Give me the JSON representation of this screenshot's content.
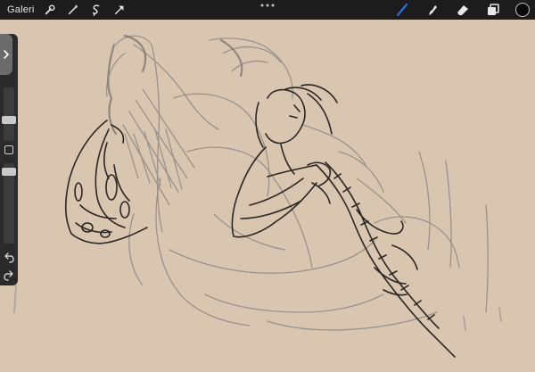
{
  "app": {
    "gallery_label": "Galeri"
  },
  "toolbar": {
    "left_tools": [
      "wrench-icon",
      "magic-wand-icon",
      "selection-icon",
      "transform-arrow-icon"
    ],
    "right_tools": [
      "brush-icon",
      "smudge-icon",
      "eraser-icon",
      "layers-icon"
    ],
    "active_tool": "brush-icon",
    "active_color": "#0a0a0a",
    "accent_color": "#2a6fdb"
  },
  "sidebar": {
    "brush_size_level": 0.55,
    "opacity_level": 0.1
  },
  "canvas": {
    "background_color": "#d8c6b1"
  }
}
